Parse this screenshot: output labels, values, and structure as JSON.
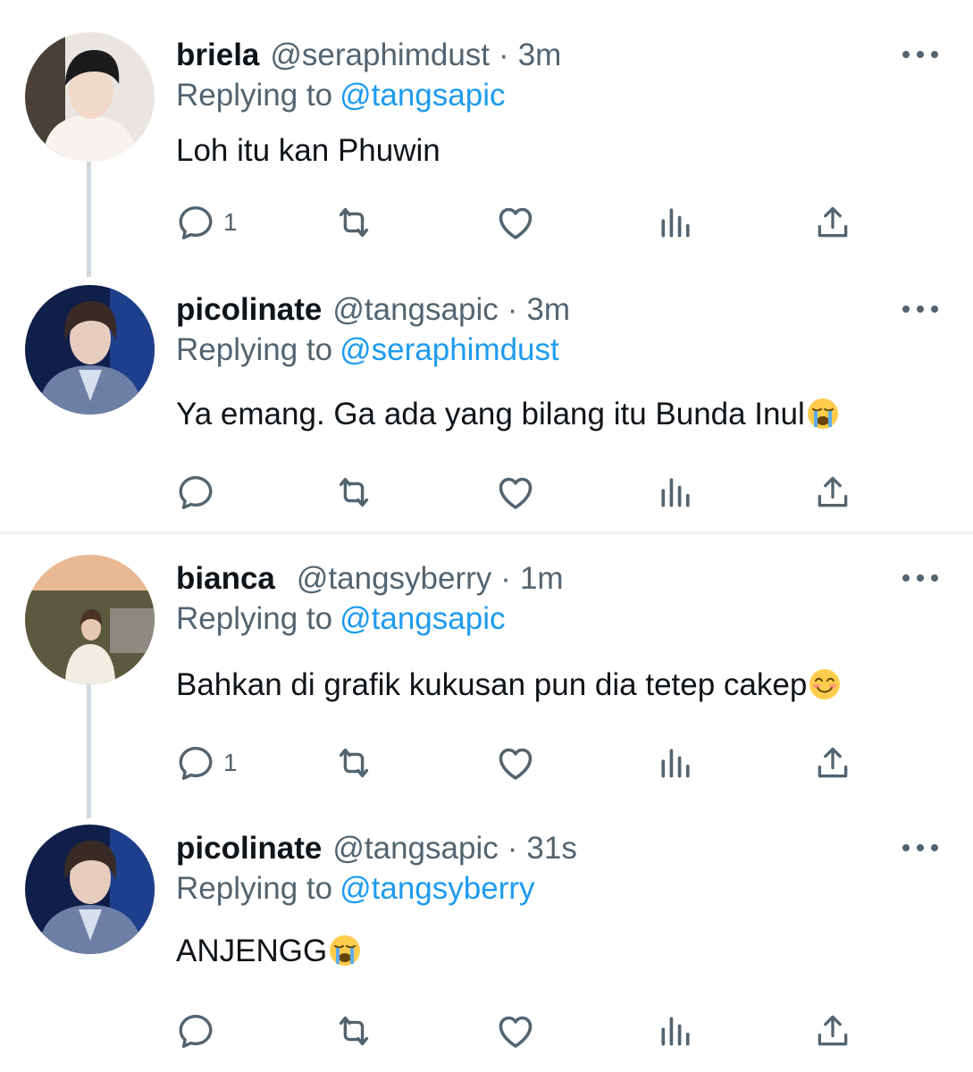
{
  "colors": {
    "text": "#0f1419",
    "secondary": "#536471",
    "link": "#1d9bf0",
    "thread_line": "#cfd9de",
    "divider": "#eff3f4"
  },
  "separator": "·",
  "reply_prefix": "Replying to",
  "threads": [
    {
      "tweets": [
        {
          "name": "briela",
          "handle": "@seraphimdust",
          "time": "3m",
          "reply_to": "@tangsapic",
          "text": "Loh itu kan Phuwin",
          "emoji": "",
          "reply_count": "1",
          "avatar_icon": "avatar-photo-icon"
        },
        {
          "name": "picolinate",
          "handle": "@tangsapic",
          "time": "3m",
          "reply_to": "@seraphimdust",
          "text": "Ya emang. Ga ada yang bilang itu Bunda Inul",
          "emoji": "crying-face-emoji",
          "reply_count": "",
          "avatar_icon": "avatar-photo-icon"
        }
      ]
    },
    {
      "tweets": [
        {
          "name": "bianca",
          "handle": "@tangsyberry",
          "time": "1m",
          "reply_to": "@tangsapic",
          "text": "Bahkan di grafik kukusan pun dia tetep cakep",
          "emoji": "smiling-face-emoji",
          "reply_count": "1",
          "avatar_icon": "avatar-photo-icon"
        },
        {
          "name": "picolinate",
          "handle": "@tangsapic",
          "time": "31s",
          "reply_to": "@tangsyberry",
          "text": "ANJENGG",
          "emoji": "crying-face-emoji",
          "reply_count": "",
          "avatar_icon": "avatar-photo-icon"
        }
      ]
    }
  ]
}
